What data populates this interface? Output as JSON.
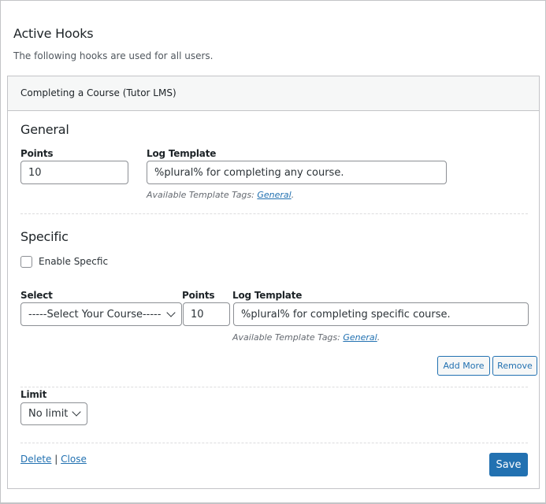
{
  "page": {
    "title": "Active Hooks",
    "description": "The following hooks are used for all users."
  },
  "hook": {
    "title": "Completing a Course (Tutor LMS)",
    "general": {
      "heading": "General",
      "points_label": "Points",
      "points_value": "10",
      "log_label": "Log Template",
      "log_value": "%plural% for completing any course.",
      "help_prefix": "Available Template Tags: ",
      "help_link": "General",
      "help_suffix": "."
    },
    "specific": {
      "heading": "Specific",
      "enable_label": "Enable Specfic",
      "enable_checked": false,
      "select_label": "Select",
      "select_value": "-----Select Your Course-----",
      "points_label": "Points",
      "points_value": "10",
      "log_label": "Log Template",
      "log_value": "%plural% for completing specific course.",
      "help_prefix": "Available Template Tags: ",
      "help_link": "General",
      "help_suffix": ".",
      "add_more_label": "Add More",
      "remove_label": "Remove"
    },
    "limit": {
      "label": "Limit",
      "value": "No limit"
    },
    "footer": {
      "delete_label": "Delete",
      "separator": "|",
      "close_label": "Close",
      "save_label": "Save"
    }
  },
  "colors": {
    "accent": "#2271b1",
    "header_bg": "#f6f7f7",
    "border": "#c3c4c7"
  }
}
